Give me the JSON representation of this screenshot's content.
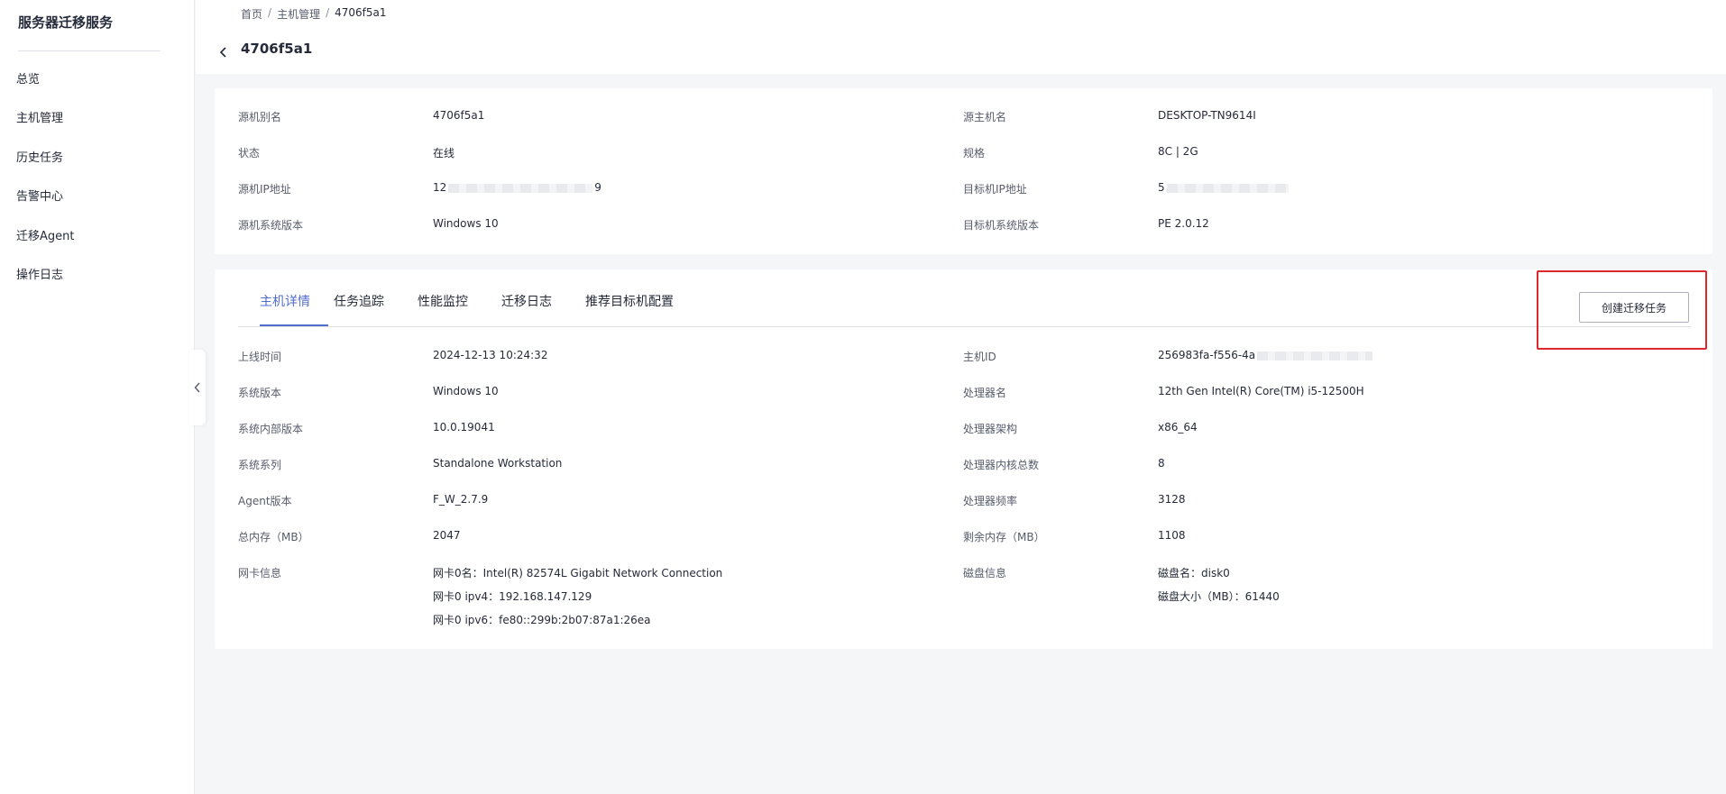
{
  "sidebar": {
    "app_title": "服务器迁移服务",
    "items": [
      {
        "label": "总览"
      },
      {
        "label": "主机管理"
      },
      {
        "label": "历史任务"
      },
      {
        "label": "告警中心"
      },
      {
        "label": "迁移Agent"
      },
      {
        "label": "操作日志"
      }
    ]
  },
  "breadcrumb": {
    "home": "首页",
    "sep": "/",
    "host_mgmt": "主机管理",
    "current": "4706f5a1"
  },
  "page_title": "4706f5a1",
  "summary": {
    "alias_label": "源机别名",
    "alias_value": "4706f5a1",
    "hostname_label": "源主机名",
    "hostname_value": "DESKTOP-TN9614I",
    "status_label": "状态",
    "status_value": "在线",
    "spec_label": "规格",
    "spec_value": "8C | 2G",
    "src_ip_label": "源机IP地址",
    "src_ip_prefix": "12",
    "src_ip_suffix": "9",
    "target_ip_label": "目标机IP地址",
    "target_ip_prefix": "5",
    "src_os_label": "源机系统版本",
    "src_os_value": "Windows 10",
    "target_os_label": "目标机系统版本",
    "target_os_value": "PE 2.0.12"
  },
  "tabs": [
    {
      "label": "主机详情",
      "active": true
    },
    {
      "label": "任务追踪"
    },
    {
      "label": "性能监控"
    },
    {
      "label": "迁移日志"
    },
    {
      "label": "推荐目标机配置"
    }
  ],
  "create_task_button": "创建迁移任务",
  "details": {
    "online_time_label": "上线时间",
    "online_time_value": "2024-12-13 10:24:32",
    "host_id_label": "主机ID",
    "host_id_prefix": "256983fa-f556-4a",
    "os_version_label": "系统版本",
    "os_version_value": "Windows 10",
    "cpu_name_label": "处理器名",
    "cpu_name_value": "12th Gen Intel(R) Core(TM) i5-12500H",
    "os_build_label": "系统内部版本",
    "os_build_value": "10.0.19041",
    "cpu_arch_label": "处理器架构",
    "cpu_arch_value": "x86_64",
    "os_family_label": "系统系列",
    "os_family_value": "Standalone Workstation",
    "cpu_cores_label": "处理器内核总数",
    "cpu_cores_value": "8",
    "agent_version_label": "Agent版本",
    "agent_version_value": "F_W_2.7.9",
    "cpu_freq_label": "处理器频率",
    "cpu_freq_value": "3128",
    "total_mem_label": "总内存（MB）",
    "total_mem_value": "2047",
    "free_mem_label": "剩余内存（MB）",
    "free_mem_value": "1108",
    "nic_label": "网卡信息",
    "nic_lines": [
      "网卡0名：Intel(R) 82574L Gigabit Network Connection",
      "网卡0 ipv4：192.168.147.129",
      "网卡0 ipv6：fe80::299b:2b07:87a1:26ea"
    ],
    "disk_label": "磁盘信息",
    "disk_lines": [
      "磁盘名：disk0",
      "磁盘大小（MB）：61440"
    ]
  },
  "colors": {
    "accent": "#526ecc",
    "highlight": "#e0262d"
  }
}
